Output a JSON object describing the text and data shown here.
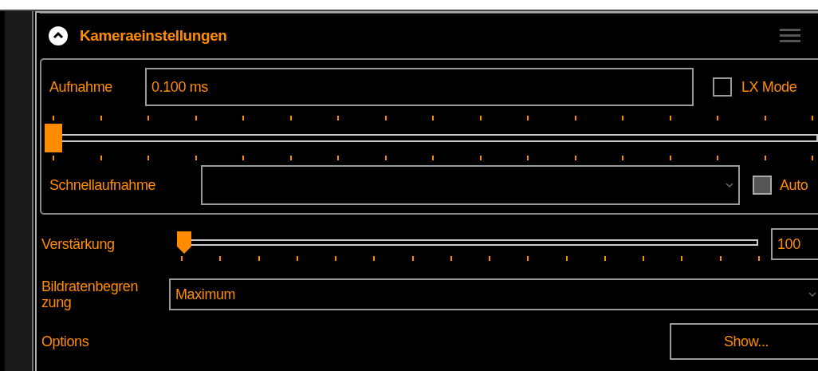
{
  "panel": {
    "title": "Kameraeinstellungen",
    "expanded": true
  },
  "exposure": {
    "label": "Aufnahme",
    "value": "0.100 ms",
    "level": 0
  },
  "lx_mode": {
    "label": "LX Mode",
    "checked": false
  },
  "quick_exposure": {
    "label": "Schnellaufnahme"
  },
  "auto": {
    "label": "Auto",
    "checked": false,
    "disabled": true
  },
  "gain": {
    "label": "Verstärkung",
    "level": 0,
    "value": "100"
  },
  "frame_rate_limit": {
    "label": "Bildratenbegren zung",
    "value": "Maximum"
  },
  "options": {
    "label": "Options",
    "button": "Show..."
  }
}
